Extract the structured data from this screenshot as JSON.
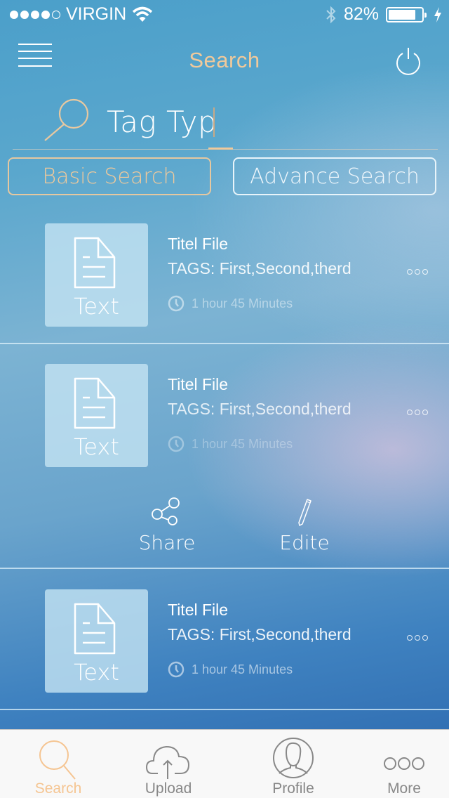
{
  "status_bar": {
    "signal_bars_filled": 4,
    "signal_bars_total": 5,
    "carrier": "VIRGIN",
    "wifi_icon": "wifi-icon",
    "bluetooth_icon": "bluetooth-icon",
    "battery_percent_text": "82%",
    "battery_level": 0.82,
    "charging_icon": "bolt-icon"
  },
  "nav": {
    "title": "Search",
    "menu_icon": "hamburger-icon",
    "power_icon": "power-icon"
  },
  "search": {
    "value": "Tag Typ",
    "placeholder": "",
    "icon": "search-icon"
  },
  "segments": {
    "basic": "Basic Search",
    "advance": "Advance Search",
    "active": "basic"
  },
  "results": [
    {
      "thumb_label": "Text",
      "title": "Titel File",
      "tags": "TAGS: First,Second,therd",
      "time": "1 hour 45 Minutes"
    },
    {
      "thumb_label": "Text",
      "title": "Titel File",
      "tags": "TAGS: First,Second,therd",
      "time": "1 hour 45 Minutes",
      "actions": [
        {
          "label": "Share",
          "icon": "share-icon"
        },
        {
          "label": "Edite",
          "icon": "pencil-icon"
        }
      ]
    },
    {
      "thumb_label": "Text",
      "title": "Titel File",
      "tags": "TAGS: First,Second,therd",
      "time": "1 hour 45 Minutes"
    }
  ],
  "tabbar": {
    "items": [
      {
        "label": "Search",
        "icon": "search-icon",
        "active": true
      },
      {
        "label": "Upload",
        "icon": "cloud-upload-icon",
        "active": false
      },
      {
        "label": "Profile",
        "icon": "profile-icon",
        "active": false
      },
      {
        "label": "More",
        "icon": "more-icon",
        "active": false
      }
    ]
  },
  "colors": {
    "accent": "#f0c99b",
    "tab_inactive": "#888888",
    "tabbar_bg": "#f8f8f8"
  }
}
